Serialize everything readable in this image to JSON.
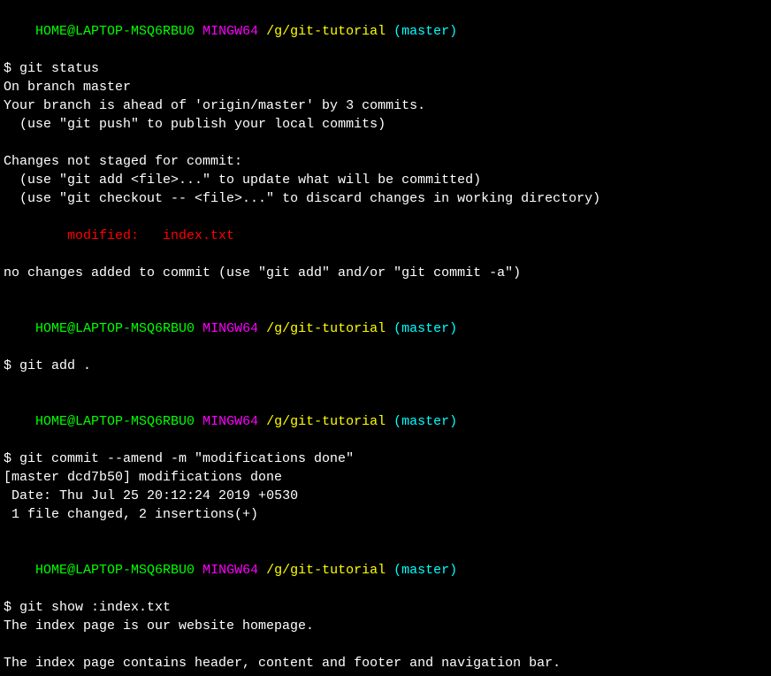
{
  "prompts": {
    "user_host": "HOME@LAPTOP-MSQ6RBU0",
    "shell": "MINGW64",
    "path": "/g/git-tutorial",
    "branch": "(master)"
  },
  "commands": {
    "status": "$ git status",
    "add": "$ git add .",
    "commit": "$ git commit --amend -m \"modifications done\"",
    "show": "$ git show :index.txt"
  },
  "status_output": {
    "on_branch": "On branch master",
    "ahead": "Your branch is ahead of 'origin/master' by 3 commits.",
    "push_hint": "  (use \"git push\" to publish your local commits)",
    "not_staged": "Changes not staged for commit:",
    "add_hint": "  (use \"git add <file>...\" to update what will be committed)",
    "checkout_hint": "  (use \"git checkout -- <file>...\" to discard changes in working directory)",
    "modified": "        modified:   index.txt",
    "no_changes": "no changes added to commit (use \"git add\" and/or \"git commit -a\")"
  },
  "commit_output": {
    "header": "[master dcd7b50] modifications done",
    "date": " Date: Thu Jul 25 20:12:24 2019 +0530",
    "summary": " 1 file changed, 2 insertions(+)"
  },
  "show_output": {
    "line1": "The index page is our website homepage.",
    "line2": "The index page contains header, content and footer and navigation bar."
  }
}
